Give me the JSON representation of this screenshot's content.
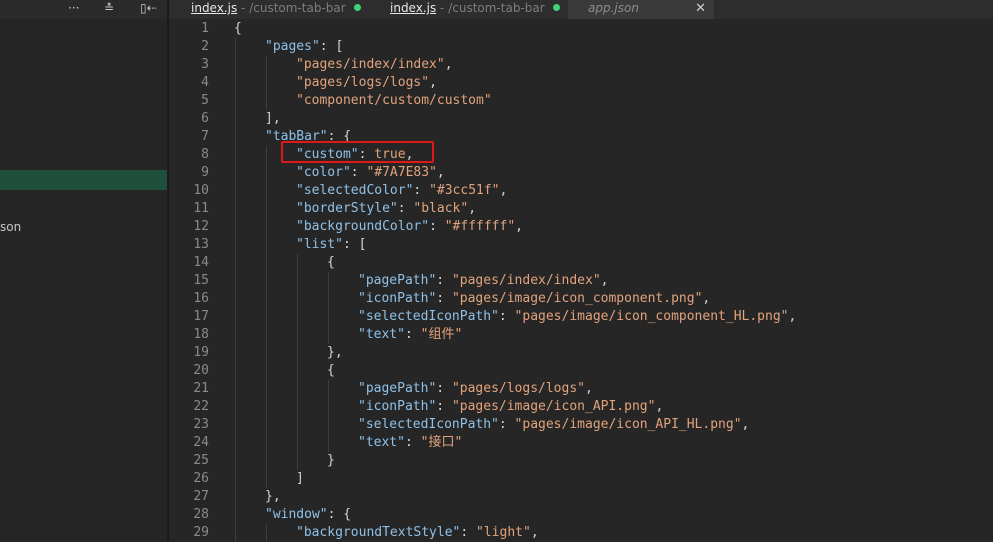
{
  "sidebar": {
    "toolbar_icons": [
      "more-icon",
      "collapse-all-icon",
      "filter-icon"
    ],
    "toolbar_glyphs": [
      "···",
      "≛",
      "▯⇠"
    ],
    "visible_fragment": "son"
  },
  "tabs": [
    {
      "name": "index.js",
      "path": " - /custom-tab-bar",
      "modified": true
    },
    {
      "name": "index.js",
      "path": " - /custom-tab-bar",
      "modified": true
    },
    {
      "name": "app.json",
      "path": "",
      "modified": false,
      "close": "✕"
    }
  ],
  "editor": {
    "lines": [
      {
        "n": "1",
        "ind": 0,
        "tokens": [
          [
            "p",
            "{"
          ]
        ]
      },
      {
        "n": "2",
        "ind": 1,
        "tokens": [
          [
            "k",
            "\"pages\""
          ],
          [
            "p",
            ": ["
          ]
        ]
      },
      {
        "n": "3",
        "ind": 2,
        "tokens": [
          [
            "s",
            "\"pages/index/index\""
          ],
          [
            "p",
            ","
          ]
        ]
      },
      {
        "n": "4",
        "ind": 2,
        "tokens": [
          [
            "s",
            "\"pages/logs/logs\""
          ],
          [
            "p",
            ","
          ]
        ]
      },
      {
        "n": "5",
        "ind": 2,
        "tokens": [
          [
            "s",
            "\"component/custom/custom\""
          ]
        ]
      },
      {
        "n": "6",
        "ind": 1,
        "tokens": [
          [
            "p",
            "],"
          ]
        ]
      },
      {
        "n": "7",
        "ind": 1,
        "tokens": [
          [
            "k",
            "\"tabBar\""
          ],
          [
            "p",
            ": {"
          ]
        ]
      },
      {
        "n": "8",
        "ind": 2,
        "tokens": [
          [
            "k",
            "\"custom\""
          ],
          [
            "p",
            ": "
          ],
          [
            "b",
            "true"
          ],
          [
            "p",
            ","
          ]
        ]
      },
      {
        "n": "9",
        "ind": 2,
        "tokens": [
          [
            "k",
            "\"color\""
          ],
          [
            "p",
            ": "
          ],
          [
            "s",
            "\"#7A7E83\""
          ],
          [
            "p",
            ","
          ]
        ]
      },
      {
        "n": "10",
        "ind": 2,
        "tokens": [
          [
            "k",
            "\"selectedColor\""
          ],
          [
            "p",
            ": "
          ],
          [
            "s",
            "\"#3cc51f\""
          ],
          [
            "p",
            ","
          ]
        ]
      },
      {
        "n": "11",
        "ind": 2,
        "tokens": [
          [
            "k",
            "\"borderStyle\""
          ],
          [
            "p",
            ": "
          ],
          [
            "s",
            "\"black\""
          ],
          [
            "p",
            ","
          ]
        ]
      },
      {
        "n": "12",
        "ind": 2,
        "tokens": [
          [
            "k",
            "\"backgroundColor\""
          ],
          [
            "p",
            ": "
          ],
          [
            "s",
            "\"#ffffff\""
          ],
          [
            "p",
            ","
          ]
        ]
      },
      {
        "n": "13",
        "ind": 2,
        "tokens": [
          [
            "k",
            "\"list\""
          ],
          [
            "p",
            ": ["
          ]
        ]
      },
      {
        "n": "14",
        "ind": 3,
        "tokens": [
          [
            "p",
            "{"
          ]
        ]
      },
      {
        "n": "15",
        "ind": 4,
        "tokens": [
          [
            "k",
            "\"pagePath\""
          ],
          [
            "p",
            ": "
          ],
          [
            "s",
            "\"pages/index/index\""
          ],
          [
            "p",
            ","
          ]
        ]
      },
      {
        "n": "16",
        "ind": 4,
        "tokens": [
          [
            "k",
            "\"iconPath\""
          ],
          [
            "p",
            ": "
          ],
          [
            "s",
            "\"pages/image/icon_component.png\""
          ],
          [
            "p",
            ","
          ]
        ]
      },
      {
        "n": "17",
        "ind": 4,
        "tokens": [
          [
            "k",
            "\"selectedIconPath\""
          ],
          [
            "p",
            ": "
          ],
          [
            "s",
            "\"pages/image/icon_component_HL.png\""
          ],
          [
            "p",
            ","
          ]
        ]
      },
      {
        "n": "18",
        "ind": 4,
        "tokens": [
          [
            "k",
            "\"text\""
          ],
          [
            "p",
            ": "
          ],
          [
            "s",
            "\"组件\""
          ]
        ]
      },
      {
        "n": "19",
        "ind": 3,
        "tokens": [
          [
            "p",
            "},"
          ]
        ]
      },
      {
        "n": "20",
        "ind": 3,
        "tokens": [
          [
            "p",
            "{"
          ]
        ]
      },
      {
        "n": "21",
        "ind": 4,
        "tokens": [
          [
            "k",
            "\"pagePath\""
          ],
          [
            "p",
            ": "
          ],
          [
            "s",
            "\"pages/logs/logs\""
          ],
          [
            "p",
            ","
          ]
        ]
      },
      {
        "n": "22",
        "ind": 4,
        "tokens": [
          [
            "k",
            "\"iconPath\""
          ],
          [
            "p",
            ": "
          ],
          [
            "s",
            "\"pages/image/icon_API.png\""
          ],
          [
            "p",
            ","
          ]
        ]
      },
      {
        "n": "23",
        "ind": 4,
        "tokens": [
          [
            "k",
            "\"selectedIconPath\""
          ],
          [
            "p",
            ": "
          ],
          [
            "s",
            "\"pages/image/icon_API_HL.png\""
          ],
          [
            "p",
            ","
          ]
        ]
      },
      {
        "n": "24",
        "ind": 4,
        "tokens": [
          [
            "k",
            "\"text\""
          ],
          [
            "p",
            ": "
          ],
          [
            "s",
            "\"接口\""
          ]
        ]
      },
      {
        "n": "25",
        "ind": 3,
        "tokens": [
          [
            "p",
            "}"
          ]
        ]
      },
      {
        "n": "26",
        "ind": 2,
        "tokens": [
          [
            "p",
            "]"
          ]
        ]
      },
      {
        "n": "27",
        "ind": 1,
        "tokens": [
          [
            "p",
            "},"
          ]
        ]
      },
      {
        "n": "28",
        "ind": 1,
        "tokens": [
          [
            "k",
            "\"window\""
          ],
          [
            "p",
            ": {"
          ]
        ]
      },
      {
        "n": "29",
        "ind": 2,
        "tokens": [
          [
            "k",
            "\"backgroundTextStyle\""
          ],
          [
            "p",
            ": "
          ],
          [
            "s",
            "\"light\""
          ],
          [
            "p",
            ","
          ]
        ]
      }
    ]
  },
  "annotation": {
    "target_line": "8",
    "color": "#e01818"
  },
  "colors": {
    "key": "#8fc1e8",
    "string": "#e2a37c",
    "punct": "#d4d4d4",
    "gutter": "#8a8a8a",
    "modified_dot": "#3ed37a"
  }
}
